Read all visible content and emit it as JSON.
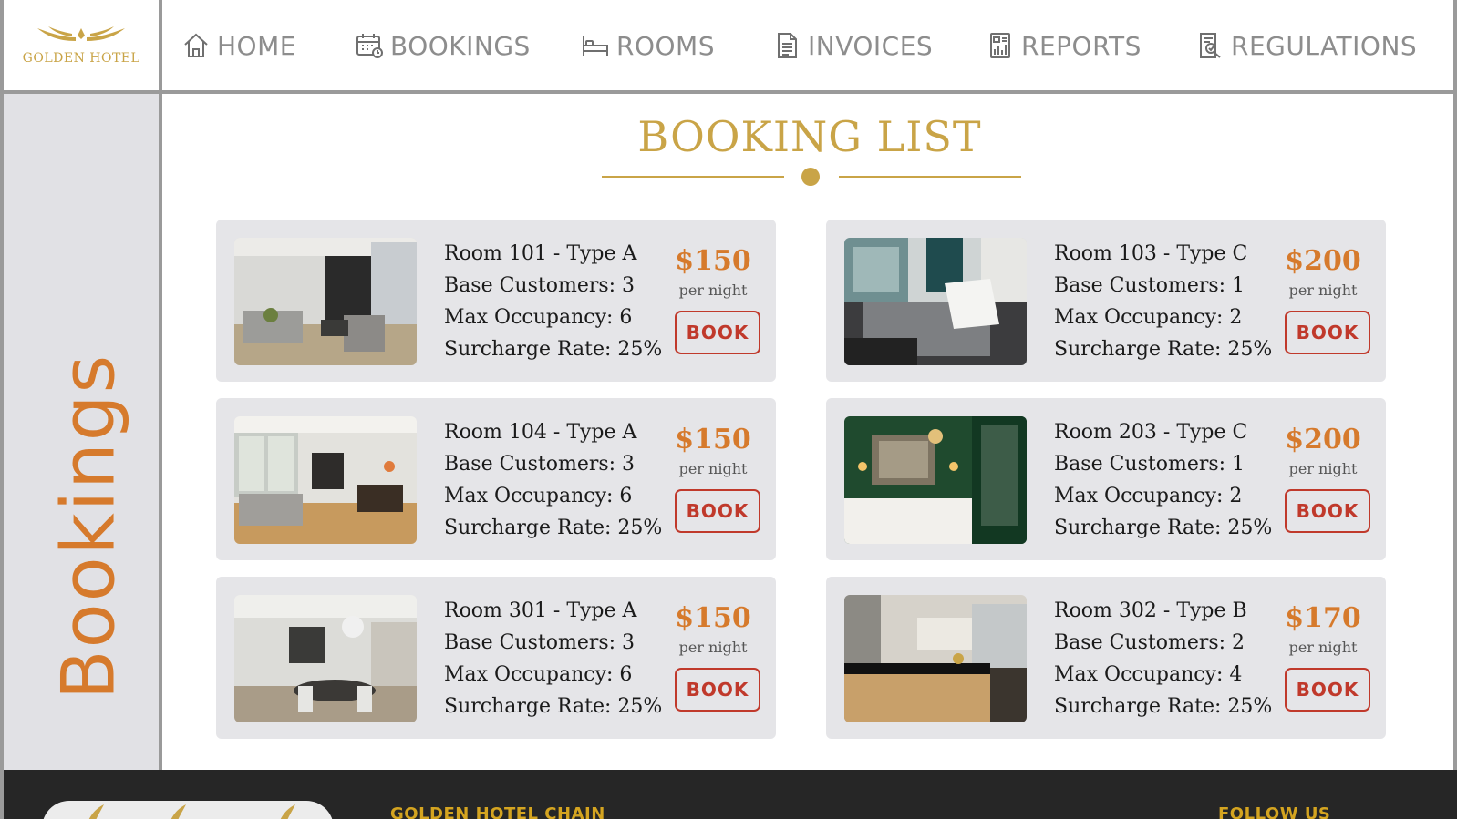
{
  "brand": {
    "name": "GOLDEN HOTEL",
    "wings": "≈≈♛≈≈"
  },
  "nav": {
    "items": [
      {
        "label": "HOME",
        "icon": "home-icon"
      },
      {
        "label": "BOOKINGS",
        "icon": "calendar-icon"
      },
      {
        "label": "ROOMS",
        "icon": "bed-icon"
      },
      {
        "label": "INVOICES",
        "icon": "document-icon"
      },
      {
        "label": "REPORTS",
        "icon": "report-icon"
      },
      {
        "label": "REGULATIONS",
        "icon": "regulation-icon"
      }
    ]
  },
  "sidebar": {
    "label": "Bookings"
  },
  "page": {
    "title": "BOOKING LIST"
  },
  "rooms": [
    {
      "name": "Room 101 - Type A",
      "base": "Base Customers: 3",
      "max": "Max Occupancy: 6",
      "surcharge": "Surcharge Rate: 25%",
      "price": "$150",
      "per": "per night",
      "book": "BOOK"
    },
    {
      "name": "Room 103 - Type C",
      "base": "Base Customers: 1",
      "max": "Max Occupancy: 2",
      "surcharge": "Surcharge Rate: 25%",
      "price": "$200",
      "per": "per night",
      "book": "BOOK"
    },
    {
      "name": "Room 104 - Type A",
      "base": "Base Customers: 3",
      "max": "Max Occupancy: 6",
      "surcharge": "Surcharge Rate: 25%",
      "price": "$150",
      "per": "per night",
      "book": "BOOK"
    },
    {
      "name": "Room 203 - Type C",
      "base": "Base Customers: 1",
      "max": "Max Occupancy: 2",
      "surcharge": "Surcharge Rate: 25%",
      "price": "$200",
      "per": "per night",
      "book": "BOOK"
    },
    {
      "name": "Room 301 - Type A",
      "base": "Base Customers: 3",
      "max": "Max Occupancy: 6",
      "surcharge": "Surcharge Rate: 25%",
      "price": "$150",
      "per": "per night",
      "book": "BOOK"
    },
    {
      "name": "Room 302 - Type B",
      "base": "Base Customers: 2",
      "max": "Max Occupancy: 4",
      "surcharge": "Surcharge Rate: 25%",
      "price": "$170",
      "per": "per night",
      "book": "BOOK"
    }
  ],
  "footer": {
    "chain": "GOLDEN HOTEL CHAIN",
    "follow": "FOLLOW US"
  },
  "colors": {
    "gold": "#c9a447",
    "orange": "#d67a2c",
    "red": "#c0392b",
    "footer_bg": "#262626"
  }
}
